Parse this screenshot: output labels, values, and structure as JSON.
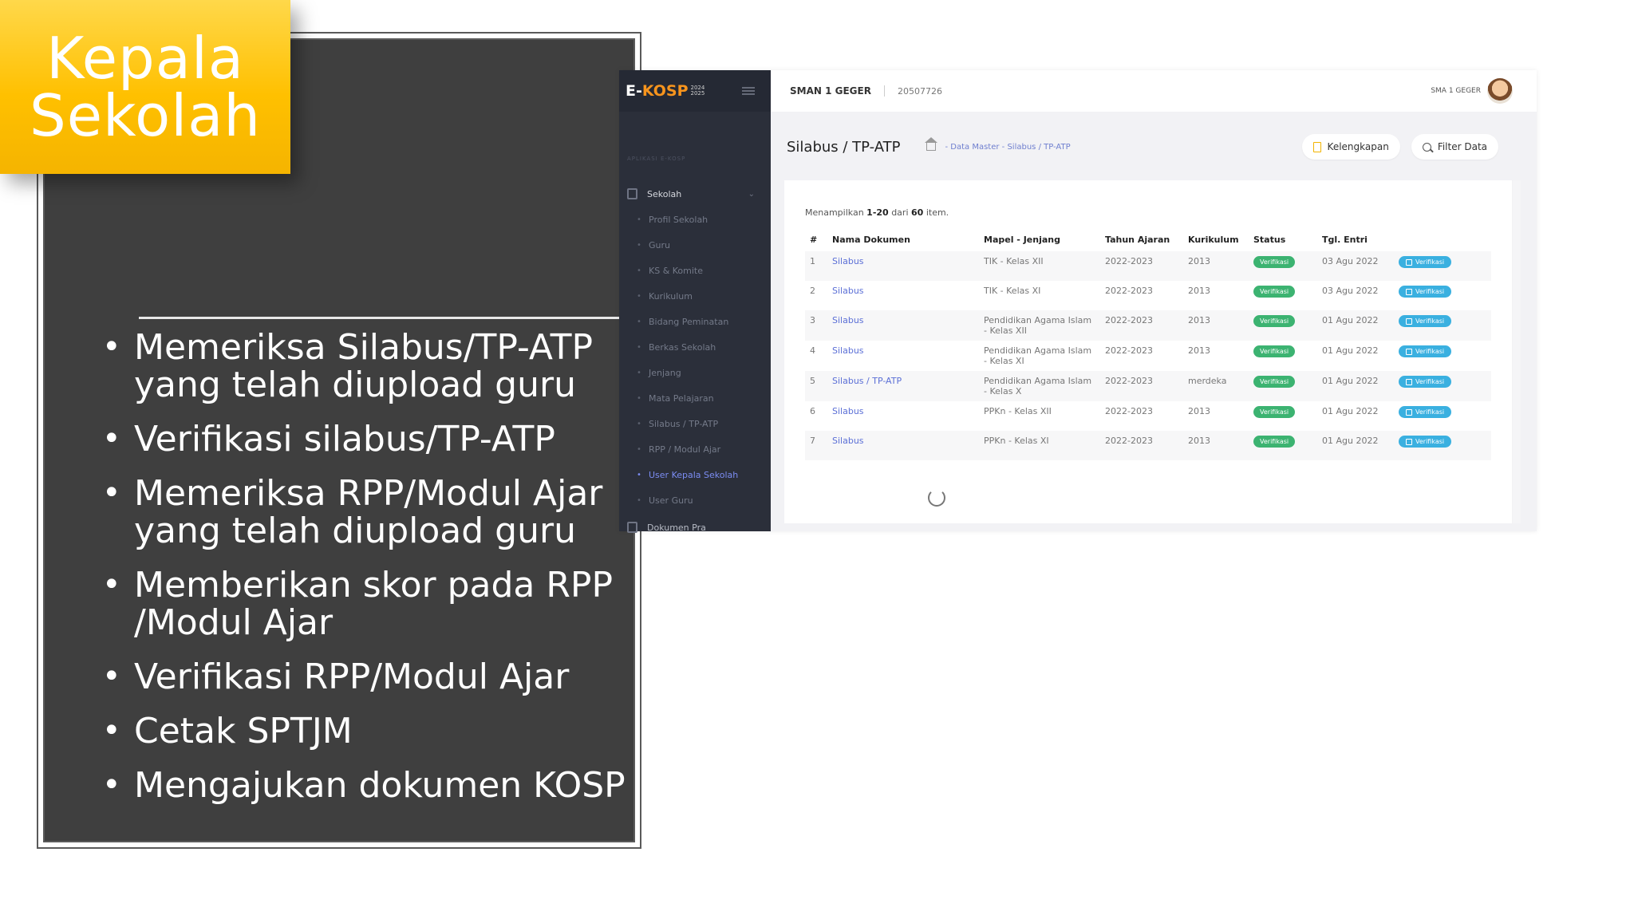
{
  "slide": {
    "title": "Kepala\nSekolah",
    "bullets": [
      "Memeriksa Silabus/TP-ATP yang telah diupload guru",
      "Verifikasi silabus/TP-ATP",
      "Memeriksa RPP/Modul Ajar yang telah diupload guru",
      "Memberikan skor pada RPP /Modul Ajar",
      "Verifikasi RPP/Modul Ajar",
      "Cetak SPTJM",
      "Mengajukan dokumen KOSP"
    ]
  },
  "app": {
    "brand": {
      "e": "E-",
      "name": "KOSP",
      "year_top": "2024",
      "year_bottom": "2025"
    },
    "sidebar": {
      "section": "APLIKASI E-KOSP",
      "group": "Sekolah",
      "items": [
        "Profil Sekolah",
        "Guru",
        "KS & Komite",
        "Kurikulum",
        "Bidang Peminatan",
        "Berkas Sekolah",
        "Jenjang",
        "Mata Pelajaran",
        "Silabus / TP-ATP",
        "RPP / Modul Ajar",
        "User Kepala Sekolah",
        "User Guru"
      ],
      "footer": "Dokumen Pra"
    },
    "topbar": {
      "school": "SMAN 1 GEGER",
      "npsn": "20507726",
      "user": "SMA 1 GEGER"
    },
    "page": {
      "title": "Silabus / TP-ATP",
      "breadcrumb": "- Data Master - Silabus / TP-ATP",
      "btn_kelengkapan": "Kelengkapan",
      "btn_filter": "Filter Data"
    },
    "table": {
      "showing_prefix": "Menampilkan",
      "showing_range": "1-20",
      "showing_mid": "dari",
      "showing_total": "60",
      "showing_suffix": "item.",
      "headers": [
        "#",
        "Nama Dokumen",
        "Mapel - Jenjang",
        "Tahun Ajaran",
        "Kurikulum",
        "Status",
        "Tgl. Entri",
        ""
      ],
      "rows": [
        {
          "no": "1",
          "doc": "Silabus",
          "mapel": "TIK - Kelas XII",
          "tahun": "2022-2023",
          "kur": "2013",
          "status": "Verifikasi",
          "tgl": "03 Agu 2022",
          "action": "Verifikasi"
        },
        {
          "no": "2",
          "doc": "Silabus",
          "mapel": "TIK - Kelas XI",
          "tahun": "2022-2023",
          "kur": "2013",
          "status": "Verifikasi",
          "tgl": "03 Agu 2022",
          "action": "Verifikasi"
        },
        {
          "no": "3",
          "doc": "Silabus",
          "mapel": "Pendidikan Agama Islam - Kelas XII",
          "tahun": "2022-2023",
          "kur": "2013",
          "status": "Verifikasi",
          "tgl": "01 Agu 2022",
          "action": "Verifikasi"
        },
        {
          "no": "4",
          "doc": "Silabus",
          "mapel": "Pendidikan Agama Islam - Kelas XI",
          "tahun": "2022-2023",
          "kur": "2013",
          "status": "Verifikasi",
          "tgl": "01 Agu 2022",
          "action": "Verifikasi"
        },
        {
          "no": "5",
          "doc": "Silabus / TP-ATP",
          "mapel": "Pendidikan Agama Islam - Kelas X",
          "tahun": "2022-2023",
          "kur": "merdeka",
          "status": "Verifikasi",
          "tgl": "01 Agu 2022",
          "action": "Verifikasi"
        },
        {
          "no": "6",
          "doc": "Silabus",
          "mapel": "PPKn - Kelas XII",
          "tahun": "2022-2023",
          "kur": "2013",
          "status": "Verifikasi",
          "tgl": "01 Agu 2022",
          "action": "Verifikasi"
        },
        {
          "no": "7",
          "doc": "Silabus",
          "mapel": "PPKn - Kelas XI",
          "tahun": "2022-2023",
          "kur": "2013",
          "status": "Verifikasi",
          "tgl": "01 Agu 2022",
          "action": "Verifikasi"
        }
      ]
    },
    "colors": {
      "accent": "#f7941d",
      "badge": "#3cb371",
      "action": "#3ab0e0",
      "title_box": "#ffc000"
    }
  }
}
